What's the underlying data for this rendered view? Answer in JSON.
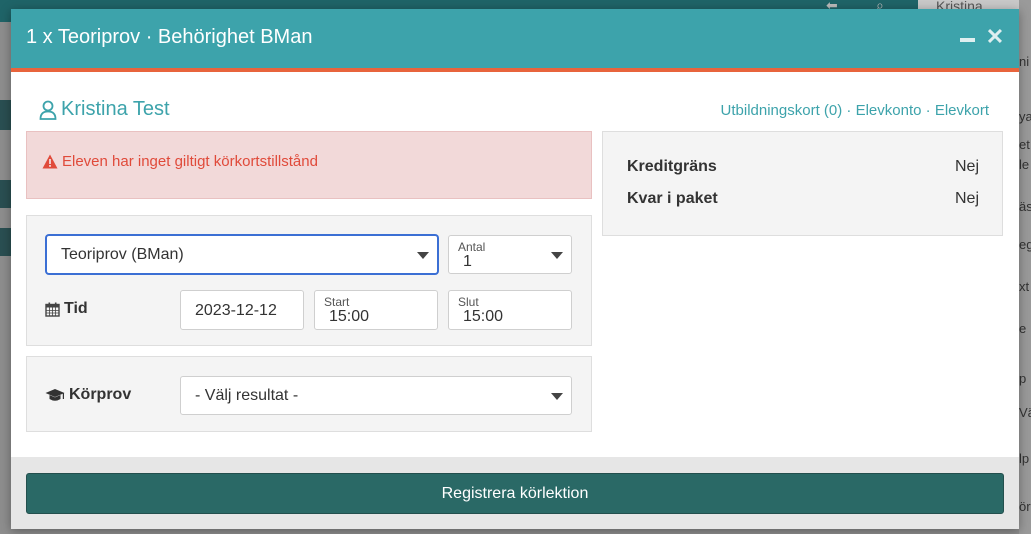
{
  "background": {
    "user_name": "Kristina",
    "right_fragments": [
      "ni",
      "ya",
      "et",
      "le",
      "äs",
      "eg",
      "xt",
      "e",
      "p",
      "Vä",
      "lp",
      "ör"
    ]
  },
  "modal": {
    "title": "1 x Teoriprov · Behörighet BMan",
    "minimize_icon": "minimize-icon",
    "close_glyph": "✕"
  },
  "student": {
    "name": "Kristina Test"
  },
  "links": {
    "education_card": "Utbildningskort (0)",
    "separator": "·",
    "student_account": "Elevkonto",
    "student_card": "Elevkort"
  },
  "alert": {
    "text": "Eleven har inget giltigt körkortstillstånd"
  },
  "form": {
    "lesson_type_value": "Teoriprov (BMan)",
    "quantity_label": "Antal",
    "quantity_value": "1",
    "time_label": "Tid",
    "date_value": "2023-12-12",
    "start_label": "Start",
    "start_value": "15:00",
    "end_label": "Slut",
    "end_value": "15:00"
  },
  "exam": {
    "label": "Körprov",
    "result_placeholder": "- Välj resultat -"
  },
  "credit": {
    "limit_label": "Kreditgräns",
    "limit_value": "Nej",
    "package_label": "Kvar i paket",
    "package_value": "Nej"
  },
  "footer": {
    "submit_label": "Registrera körlektion"
  },
  "colors": {
    "header": "#3da3ab",
    "header_accent": "#e8643c",
    "alert_bg": "#f2d9d9",
    "alert_text": "#e04a3a",
    "submit_bg": "#2a6966"
  }
}
